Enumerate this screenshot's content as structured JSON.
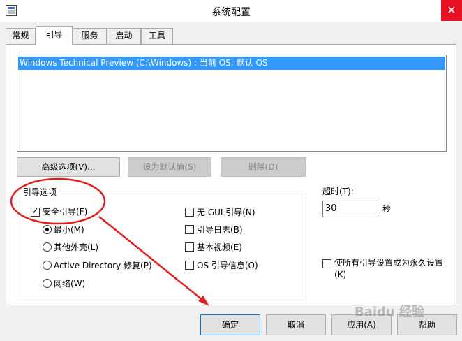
{
  "window": {
    "title": "系统配置",
    "close_glyph": "✕"
  },
  "tabs": [
    "常规",
    "引导",
    "服务",
    "启动",
    "工具"
  ],
  "os_list": {
    "items": [
      "Windows Technical Preview (C:\\Windows) : 当前 OS; 默认 OS"
    ]
  },
  "buttons": {
    "advanced": "高级选项(V)...",
    "set_default": "设为默认值(S)",
    "delete": "删除(D)",
    "ok": "确定",
    "cancel": "取消",
    "apply": "应用(A)",
    "help": "帮助"
  },
  "boot_options": {
    "title": "引导选项",
    "safe_boot": {
      "label": "安全引导(F)",
      "checked": true
    },
    "radios": [
      {
        "label": "最小(M)",
        "checked": true
      },
      {
        "label": "其他外壳(L)",
        "checked": false
      },
      {
        "label": "Active Directory 修复(P)",
        "checked": false
      },
      {
        "label": "网络(W)",
        "checked": false
      }
    ],
    "checkboxes": [
      {
        "label": "无 GUI 引导(N)",
        "checked": false
      },
      {
        "label": "引导日志(B)",
        "checked": false
      },
      {
        "label": "基本视频(E)",
        "checked": false
      },
      {
        "label": "OS 引导信息(O)",
        "checked": false
      }
    ]
  },
  "timeout": {
    "label": "超时(T):",
    "value": "30",
    "unit": "秒"
  },
  "permanent": {
    "label_line1": "使所有引导设置成为永久设置",
    "label_line2": "(K)",
    "checked": false
  },
  "watermark": "Baidu 经验",
  "annotation_color": "#e02020"
}
